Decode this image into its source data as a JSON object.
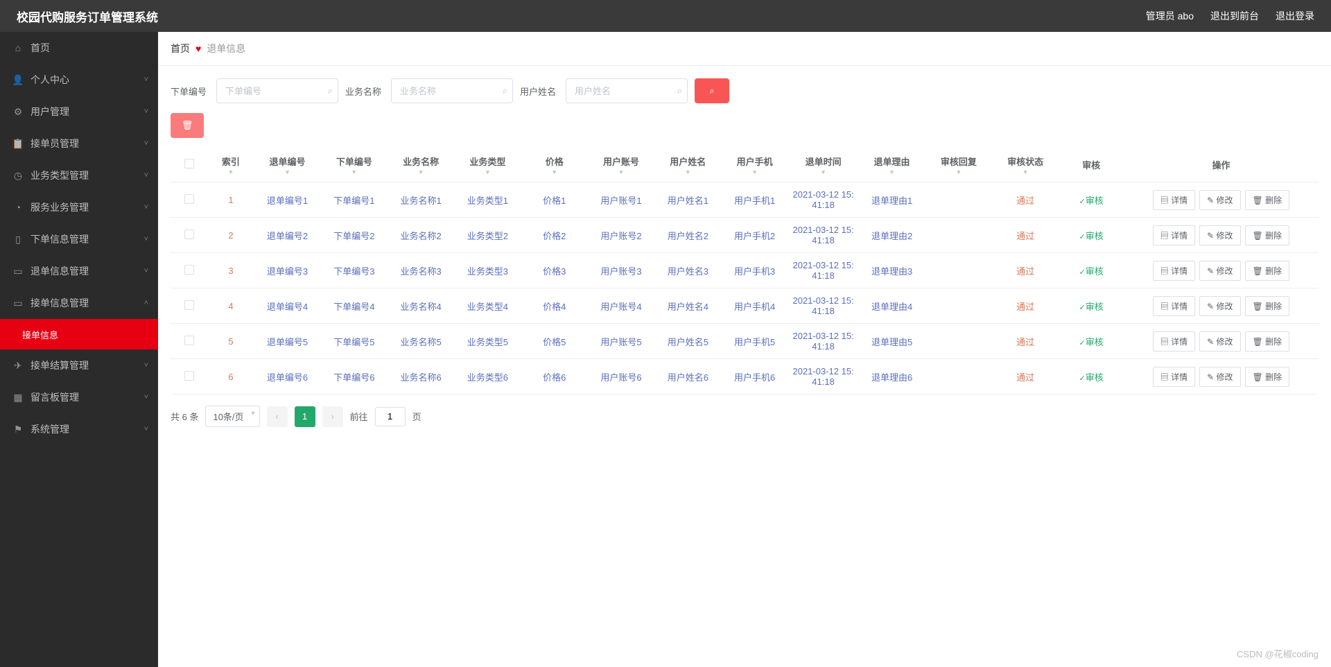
{
  "header": {
    "title": "校园代购服务订单管理系统",
    "admin": "管理员 abo",
    "to_front": "退出到前台",
    "logout": "退出登录"
  },
  "sidebar": {
    "items": [
      {
        "icon": "home",
        "label": "首页",
        "expand": false
      },
      {
        "icon": "user",
        "label": "个人中心",
        "expand": true
      },
      {
        "icon": "users",
        "label": "用户管理",
        "expand": true
      },
      {
        "icon": "clipboard",
        "label": "接单员管理",
        "expand": true
      },
      {
        "icon": "clock",
        "label": "业务类型管理",
        "expand": true
      },
      {
        "icon": "clock2",
        "label": "服务业务管理",
        "expand": true
      },
      {
        "icon": "device",
        "label": "下单信息管理",
        "expand": true
      },
      {
        "icon": "screen",
        "label": "退单信息管理",
        "expand": true
      },
      {
        "icon": "screen",
        "label": "接单信息管理",
        "expand": true,
        "open": true,
        "sub": [
          {
            "label": "接单信息",
            "active": true
          }
        ]
      },
      {
        "icon": "send",
        "label": "接单结算管理",
        "expand": true
      },
      {
        "icon": "grid",
        "label": "留言板管理",
        "expand": true
      },
      {
        "icon": "flag",
        "label": "系统管理",
        "expand": true
      }
    ]
  },
  "crumb": {
    "home": "首页",
    "current": "退单信息"
  },
  "search": {
    "f1_label": "下单编号",
    "f1_ph": "下单编号",
    "f2_label": "业务名称",
    "f2_ph": "业务名称",
    "f3_label": "用户姓名",
    "f3_ph": "用户姓名"
  },
  "table": {
    "cols": [
      "索引",
      "退单编号",
      "下单编号",
      "业务名称",
      "业务类型",
      "价格",
      "用户账号",
      "用户姓名",
      "用户手机",
      "退单时间",
      "退单理由",
      "审核回复",
      "审核状态",
      "审核",
      "操作"
    ],
    "audit_label": "审核",
    "op_detail": "详情",
    "op_edit": "修改",
    "op_del": "删除",
    "rows": [
      {
        "idx": "1",
        "a": "退单编号1",
        "b": "下单编号1",
        "c": "业务名称1",
        "d": "业务类型1",
        "e": "价格1",
        "f": "用户账号1",
        "g": "用户姓名1",
        "h": "用户手机1",
        "t": "2021-03-12 15:41:18",
        "r": "退单理由1",
        "reply": "",
        "s": "通过"
      },
      {
        "idx": "2",
        "a": "退单编号2",
        "b": "下单编号2",
        "c": "业务名称2",
        "d": "业务类型2",
        "e": "价格2",
        "f": "用户账号2",
        "g": "用户姓名2",
        "h": "用户手机2",
        "t": "2021-03-12 15:41:18",
        "r": "退单理由2",
        "reply": "",
        "s": "通过"
      },
      {
        "idx": "3",
        "a": "退单编号3",
        "b": "下单编号3",
        "c": "业务名称3",
        "d": "业务类型3",
        "e": "价格3",
        "f": "用户账号3",
        "g": "用户姓名3",
        "h": "用户手机3",
        "t": "2021-03-12 15:41:18",
        "r": "退单理由3",
        "reply": "",
        "s": "通过"
      },
      {
        "idx": "4",
        "a": "退单编号4",
        "b": "下单编号4",
        "c": "业务名称4",
        "d": "业务类型4",
        "e": "价格4",
        "f": "用户账号4",
        "g": "用户姓名4",
        "h": "用户手机4",
        "t": "2021-03-12 15:41:18",
        "r": "退单理由4",
        "reply": "",
        "s": "通过"
      },
      {
        "idx": "5",
        "a": "退单编号5",
        "b": "下单编号5",
        "c": "业务名称5",
        "d": "业务类型5",
        "e": "价格5",
        "f": "用户账号5",
        "g": "用户姓名5",
        "h": "用户手机5",
        "t": "2021-03-12 15:41:18",
        "r": "退单理由5",
        "reply": "",
        "s": "通过"
      },
      {
        "idx": "6",
        "a": "退单编号6",
        "b": "下单编号6",
        "c": "业务名称6",
        "d": "业务类型6",
        "e": "价格6",
        "f": "用户账号6",
        "g": "用户姓名6",
        "h": "用户手机6",
        "t": "2021-03-12 15:41:18",
        "r": "退单理由6",
        "reply": "",
        "s": "通过"
      }
    ]
  },
  "pager": {
    "total": "共 6 条",
    "size": "10条/页",
    "page": "1",
    "goto_pre": "前往",
    "goto_val": "1",
    "goto_suf": "页"
  },
  "watermark": "CSDN @花椒coding"
}
